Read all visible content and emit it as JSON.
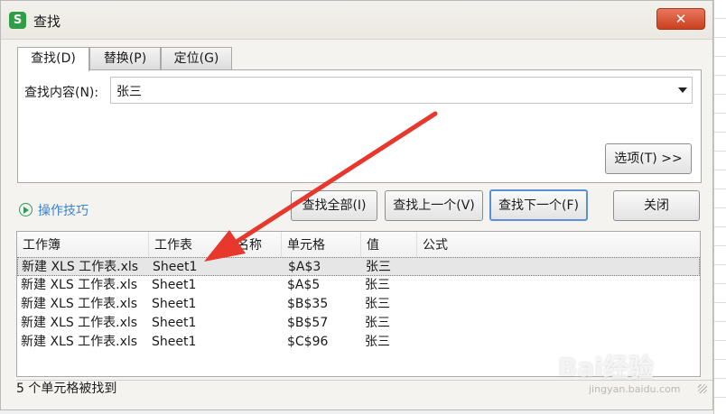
{
  "window": {
    "title": "查找",
    "app_icon_letter": "S",
    "close_glyph": "✕"
  },
  "tabs": [
    {
      "label": "查找(D)",
      "active": true
    },
    {
      "label": "替换(P)",
      "active": false
    },
    {
      "label": "定位(G)",
      "active": false
    }
  ],
  "find": {
    "label": "查找内容(N):",
    "value": "张三"
  },
  "buttons": {
    "options": "选项(T) >>",
    "find_all": "查找全部(I)",
    "find_prev": "查找上一个(V)",
    "find_next": "查找下一个(F)",
    "close": "关闭"
  },
  "tips": {
    "label": "操作技巧"
  },
  "results": {
    "columns": [
      "工作簿",
      "工作表",
      "名称",
      "单元格",
      "值",
      "公式"
    ],
    "rows": [
      {
        "workbook": "新建 XLS 工作表.xls",
        "sheet": "Sheet1",
        "name": "",
        "cell": "$A$3",
        "value": "张三",
        "formula": "",
        "selected": true
      },
      {
        "workbook": "新建 XLS 工作表.xls",
        "sheet": "Sheet1",
        "name": "",
        "cell": "$A$5",
        "value": "张三",
        "formula": "",
        "selected": false
      },
      {
        "workbook": "新建 XLS 工作表.xls",
        "sheet": "Sheet1",
        "name": "",
        "cell": "$B$35",
        "value": "张三",
        "formula": "",
        "selected": false
      },
      {
        "workbook": "新建 XLS 工作表.xls",
        "sheet": "Sheet1",
        "name": "",
        "cell": "$B$57",
        "value": "张三",
        "formula": "",
        "selected": false
      },
      {
        "workbook": "新建 XLS 工作表.xls",
        "sheet": "Sheet1",
        "name": "",
        "cell": "$C$96",
        "value": "张三",
        "formula": "",
        "selected": false
      }
    ]
  },
  "status": {
    "text": "5 个单元格被找到"
  },
  "watermark": {
    "logo": "Bai经验",
    "url": "jingyan.baidu.com"
  },
  "colors": {
    "annotation_arrow": "#e8372c",
    "tips_link": "#3a84cc",
    "app_icon": "#2f9e46"
  }
}
